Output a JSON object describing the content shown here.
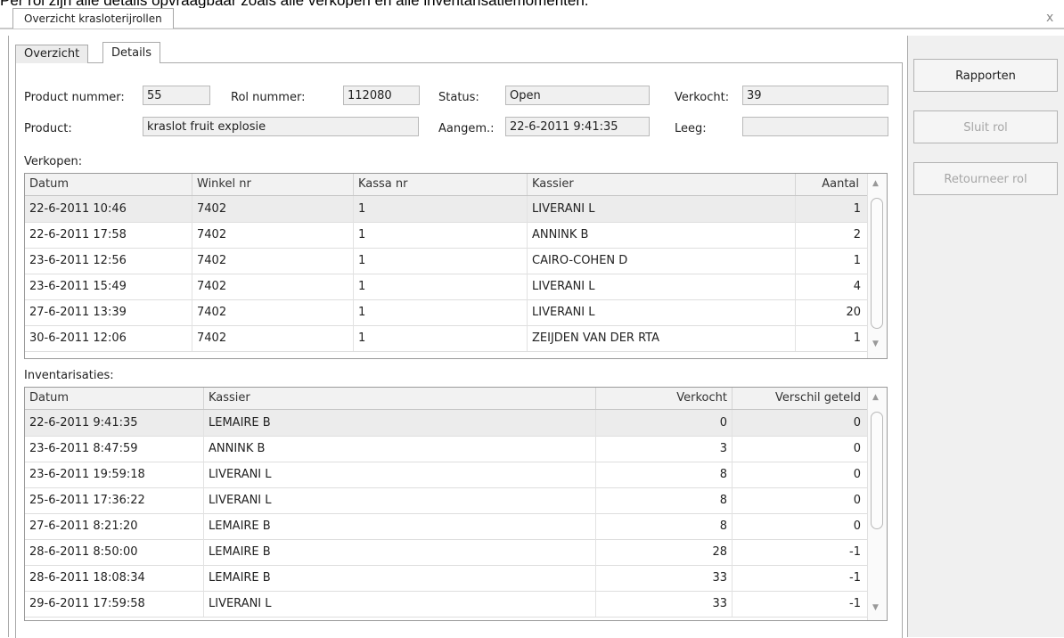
{
  "caption_text": "Per rol zijn alle details opvraagbaar zoals alle verkopen en alle inventarisatiemomenten.",
  "window": {
    "doc_tab": "Overzicht krasloterijrollen",
    "close_symbol": "x"
  },
  "tabs": {
    "overzicht": "Overzicht",
    "details": "Details"
  },
  "form": {
    "product_nummer_label": "Product nummer:",
    "product_nummer_value": "55",
    "rol_nummer_label": "Rol nummer:",
    "rol_nummer_value": "112080",
    "status_label": "Status:",
    "status_value": "Open",
    "verkocht_label": "Verkocht:",
    "verkocht_value": "39",
    "product_label": "Product:",
    "product_value": "kraslot fruit explosie",
    "aangem_label": "Aangem.:",
    "aangem_value": "22-6-2011 9:41:35",
    "leeg_label": "Leeg:",
    "leeg_value": ""
  },
  "verkopen": {
    "title": "Verkopen:",
    "columns": [
      "Datum",
      "Winkel nr",
      "Kassa nr",
      "Kassier",
      "Aantal"
    ],
    "rows": [
      {
        "datum": "22-6-2011 10:46",
        "winkel": "7402",
        "kassa": "1",
        "kassier": "LIVERANI L",
        "aantal": "1"
      },
      {
        "datum": "22-6-2011 17:58",
        "winkel": "7402",
        "kassa": "1",
        "kassier": "ANNINK B",
        "aantal": "2"
      },
      {
        "datum": "23-6-2011 12:56",
        "winkel": "7402",
        "kassa": "1",
        "kassier": "CAIRO-COHEN D",
        "aantal": "1"
      },
      {
        "datum": "23-6-2011 15:49",
        "winkel": "7402",
        "kassa": "1",
        "kassier": "LIVERANI L",
        "aantal": "4"
      },
      {
        "datum": "27-6-2011 13:39",
        "winkel": "7402",
        "kassa": "1",
        "kassier": "LIVERANI L",
        "aantal": "20"
      },
      {
        "datum": "30-6-2011 12:06",
        "winkel": "7402",
        "kassa": "1",
        "kassier": "ZEIJDEN VAN DER RTA",
        "aantal": "1"
      }
    ]
  },
  "inventarisaties": {
    "title": "Inventarisaties:",
    "columns": [
      "Datum",
      "Kassier",
      "Verkocht",
      "Verschil geteld"
    ],
    "rows": [
      {
        "datum": "22-6-2011 9:41:35",
        "kassier": "LEMAIRE B",
        "verkocht": "0",
        "verschil": "0"
      },
      {
        "datum": "23-6-2011 8:47:59",
        "kassier": "ANNINK B",
        "verkocht": "3",
        "verschil": "0"
      },
      {
        "datum": "23-6-2011 19:59:18",
        "kassier": "LIVERANI L",
        "verkocht": "8",
        "verschil": "0"
      },
      {
        "datum": "25-6-2011 17:36:22",
        "kassier": "LIVERANI L",
        "verkocht": "8",
        "verschil": "0"
      },
      {
        "datum": "27-6-2011 8:21:20",
        "kassier": "LEMAIRE B",
        "verkocht": "8",
        "verschil": "0"
      },
      {
        "datum": "28-6-2011 8:50:00",
        "kassier": "LEMAIRE B",
        "verkocht": "28",
        "verschil": "-1"
      },
      {
        "datum": "28-6-2011 18:08:34",
        "kassier": "LEMAIRE B",
        "verkocht": "33",
        "verschil": "-1"
      },
      {
        "datum": "29-6-2011 17:59:58",
        "kassier": "LIVERANI L",
        "verkocht": "33",
        "verschil": "-1"
      }
    ]
  },
  "buttons": {
    "rapporten": "Rapporten",
    "sluit_rol": "Sluit rol",
    "retourneer_rol": "Retourneer rol"
  }
}
